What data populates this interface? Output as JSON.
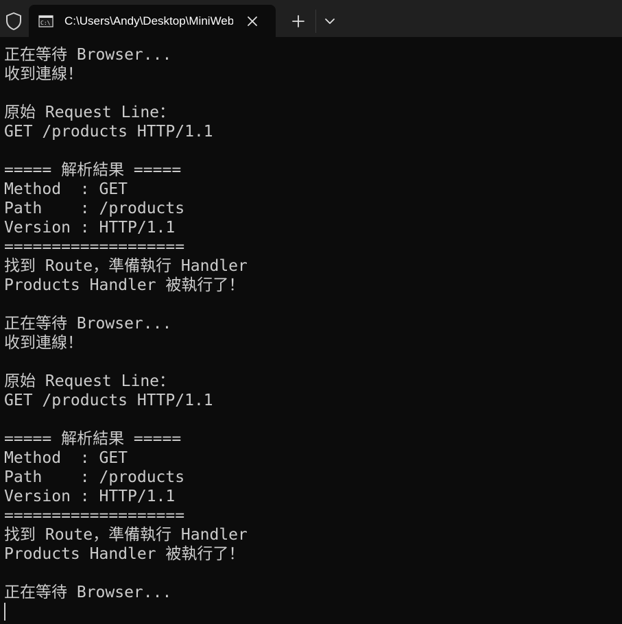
{
  "window": {
    "tab_title": "C:\\Users\\Andy\\Desktop\\MiniWeb",
    "tab_icon": "command-prompt-icon",
    "shield_icon": "shield-icon",
    "close_icon": "close-icon",
    "new_tab_icon": "plus-icon",
    "dropdown_icon": "chevron-down-icon"
  },
  "terminal": {
    "foreground": "#cccccc",
    "background": "#0c0c0c",
    "lines": [
      "正在等待 Browser...",
      "收到連線！",
      "",
      "原始 Request Line：",
      "GET /products HTTP/1.1",
      "",
      "===== 解析結果 =====",
      "Method  : GET",
      "Path    : /products",
      "Version : HTTP/1.1",
      "===================",
      "找到 Route，準備執行 Handler",
      "Products Handler 被執行了！",
      "",
      "正在等待 Browser...",
      "收到連線！",
      "",
      "原始 Request Line：",
      "GET /products HTTP/1.1",
      "",
      "===== 解析結果 =====",
      "Method  : GET",
      "Path    : /products",
      "Version : HTTP/1.1",
      "===================",
      "找到 Route，準備執行 Handler",
      "Products Handler 被執行了！",
      "",
      "正在等待 Browser..."
    ]
  }
}
